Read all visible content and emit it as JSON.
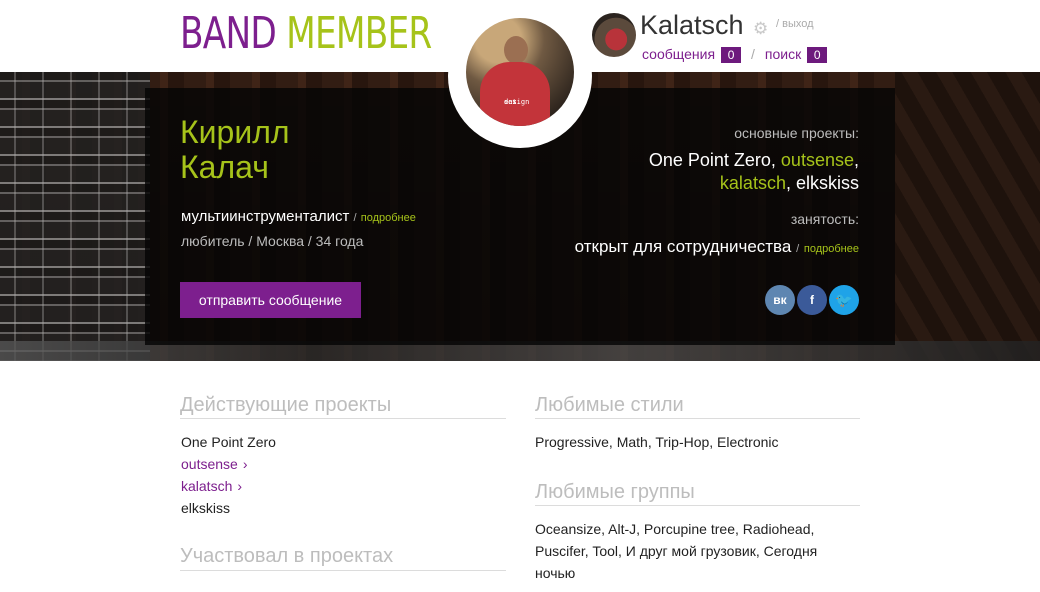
{
  "brand": {
    "part1": "BAND",
    "part2": "MEMBER"
  },
  "user_menu": {
    "username": "Kalatsch",
    "logout": "/ выход",
    "messages_label": "сообщения",
    "messages_count": "0",
    "search_label": "поиск",
    "search_count": "0",
    "separator": "/",
    "icon": "gear-icon"
  },
  "profile": {
    "first_name": "Кирилл",
    "last_name": "Калач",
    "role": "мультиинструменталист",
    "role_more": "подробнее",
    "info": "любитель / Москва / 34 года",
    "message_button": "отправить сообщение",
    "main_projects_label": "основные проекты:",
    "projects": [
      {
        "name": "One Point Zero",
        "highlight": false
      },
      {
        "name": "outsense",
        "highlight": true
      },
      {
        "name": "kalatsch",
        "highlight": true
      },
      {
        "name": "elkskiss",
        "highlight": false
      }
    ],
    "occupation_label": "занятость:",
    "occupation": "открыт для сотрудничества",
    "occupation_more": "подробнее",
    "social": {
      "vk": "вк",
      "fb": "f",
      "tw": "🐦"
    },
    "avatar_shirt_text": [
      "eat.",
      "sex.",
      "design"
    ]
  },
  "active_projects": {
    "title": "Действующие проекты",
    "items": [
      {
        "label": "One Point Zero",
        "link": false
      },
      {
        "label": "outsense",
        "link": true
      },
      {
        "label": "kalatsch",
        "link": true
      },
      {
        "label": "elkskiss",
        "link": false
      }
    ]
  },
  "past_projects": {
    "title": "Участвовал в проектах"
  },
  "styles": {
    "title": "Любимые стили",
    "text": "Progressive, Math, Trip-Hop, Electronic"
  },
  "bands": {
    "title": "Любимые группы",
    "text": "Oceansize, Alt-J, Porcupine tree, Radiohead, Puscifer, Tool, И друг мой грузовик, Сегодня ночью"
  },
  "colors": {
    "brand_purple": "#7d1f8e",
    "brand_green": "#a6c31a"
  }
}
